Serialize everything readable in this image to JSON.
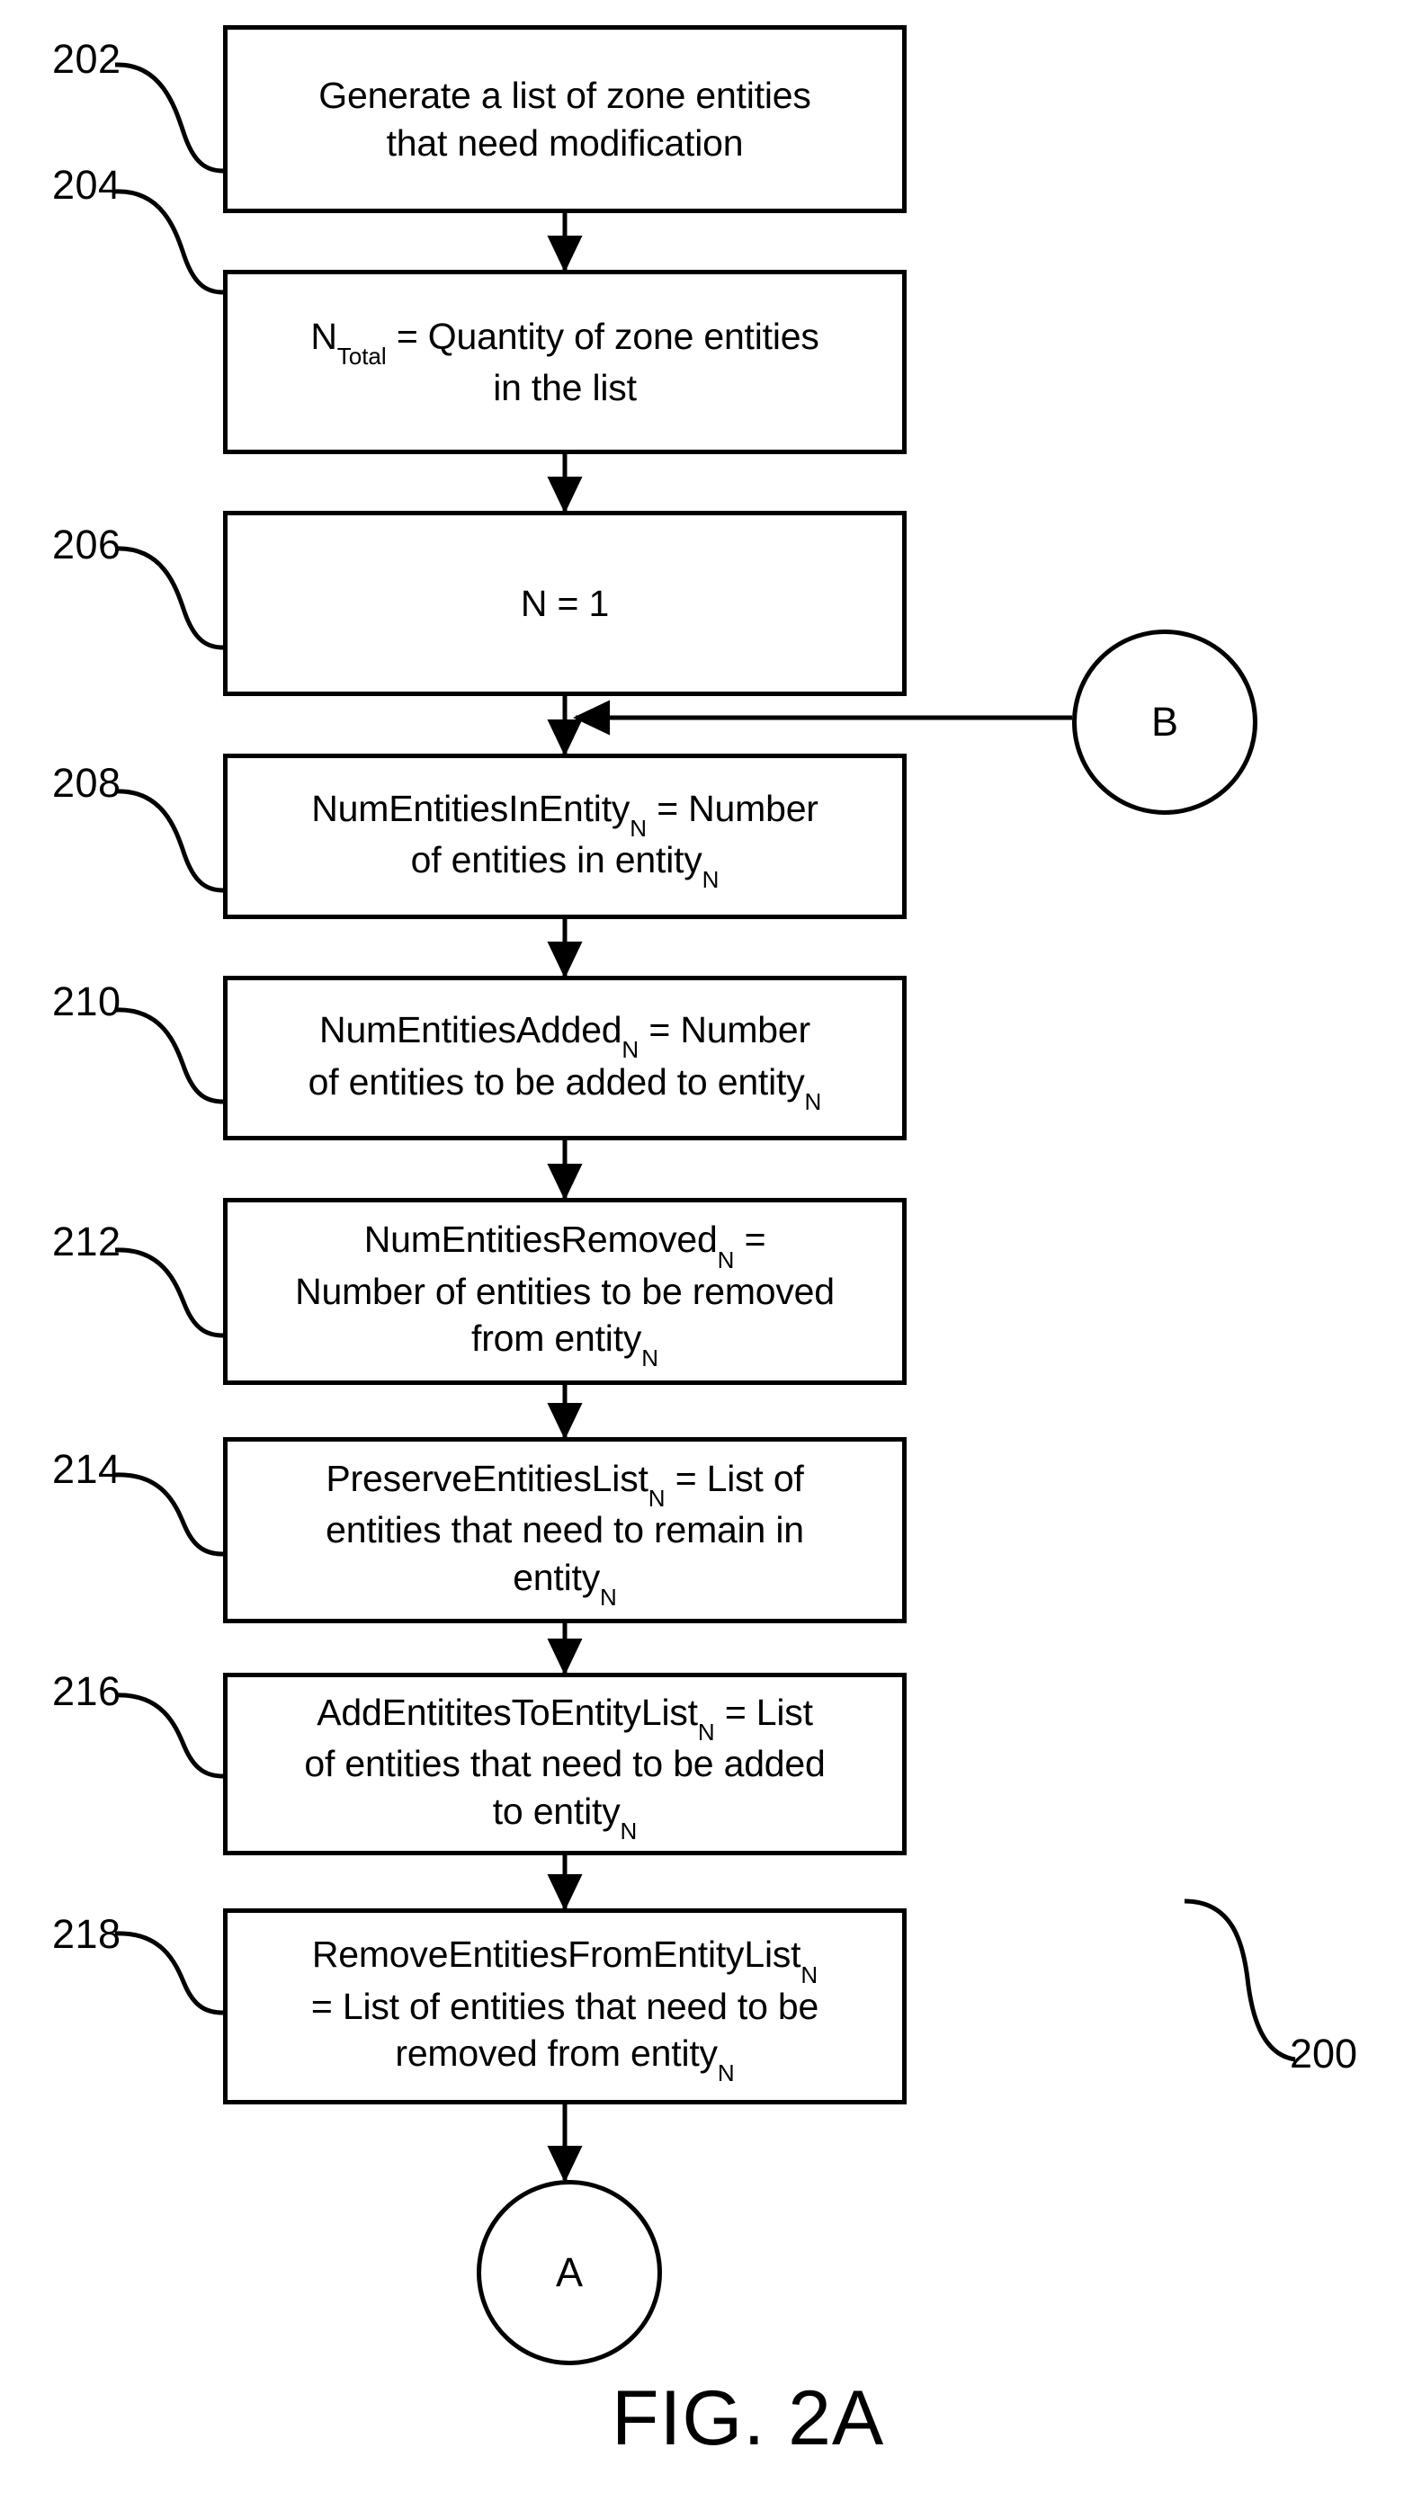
{
  "figure": {
    "caption": "FIG. 2A",
    "diagram_reference": "200"
  },
  "boxes": [
    {
      "ref": "202",
      "lines": [
        "Generate a list of zone entities",
        "that need modification"
      ]
    },
    {
      "ref": "204",
      "lines": [
        "N Total = Quantity of zone entities",
        "in the list"
      ],
      "line1_pre": "N",
      "line1_sub": "Total",
      "line1_post": "= Quantity of zone entities",
      "line2": "in the list"
    },
    {
      "ref": "206",
      "lines": [
        "N = 1"
      ]
    },
    {
      "ref": "208",
      "line1_pre": "NumEntitiesInEntity",
      "line1_sub": "N",
      "line1_post": "= Number",
      "line2_pre": "of entities in entity",
      "line2_sub": "N",
      "line2_post": ""
    },
    {
      "ref": "210",
      "line1_pre": "NumEntitiesAdded",
      "line1_sub": "N",
      "line1_post": "= Number",
      "line2_pre": "of entities to be added to entity",
      "line2_sub": "N",
      "line2_post": ""
    },
    {
      "ref": "212",
      "line1_pre": "NumEntitiesRemoved",
      "line1_sub": "N",
      "line1_post": "=",
      "line2": "Number of entities to be removed",
      "line3_pre": "from entity",
      "line3_sub": "N",
      "line3_post": ""
    },
    {
      "ref": "214",
      "line1_pre": "PreserveEntitiesList",
      "line1_sub": "N",
      "line1_post": "= List of",
      "line2": "entities that need to remain in",
      "line3_pre": "entity",
      "line3_sub": "N",
      "line3_post": ""
    },
    {
      "ref": "216",
      "line1_pre": "AddEntititesToEntityList",
      "line1_sub": "N",
      "line1_post": "= List",
      "line2": "of entities that need to be added",
      "line3_pre": "to entity",
      "line3_sub": "N",
      "line3_post": ""
    },
    {
      "ref": "218",
      "line1_pre": "RemoveEntitiesFromEntityList",
      "line1_sub": "N",
      "line1_post": "",
      "line2": "= List of entities that need to be",
      "line3_pre": "removed from entity",
      "line3_sub": "N",
      "line3_post": ""
    }
  ],
  "connectors": [
    {
      "label": "B",
      "role": "entry-connector"
    },
    {
      "label": "A",
      "role": "exit-connector"
    }
  ],
  "colors": {
    "stroke": "#000000",
    "background": "#ffffff"
  }
}
